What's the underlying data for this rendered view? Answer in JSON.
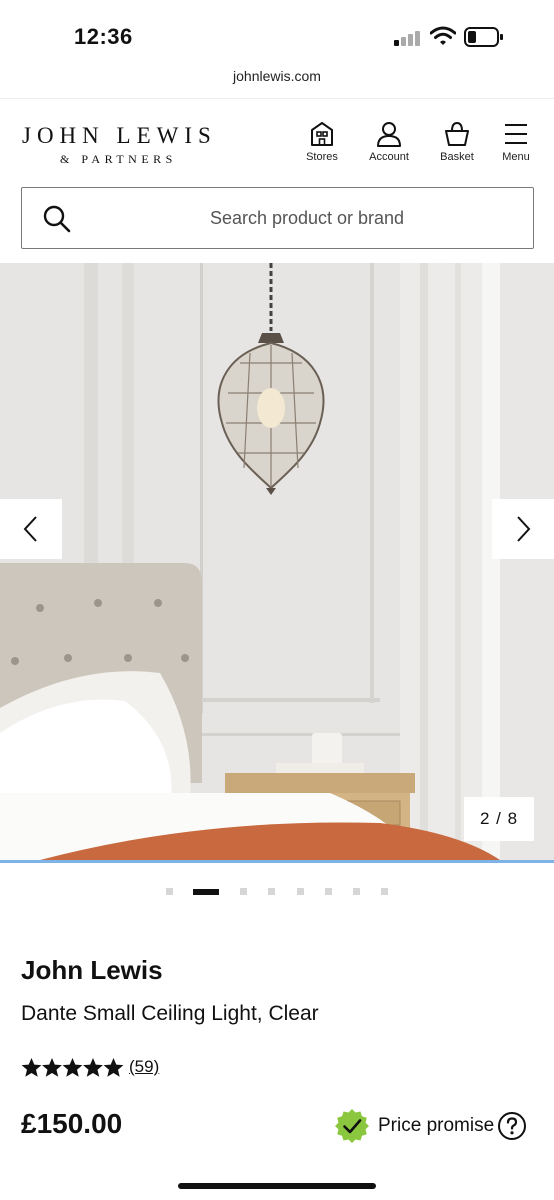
{
  "status_bar": {
    "time": "12:36"
  },
  "browser": {
    "url": "johnlewis.com"
  },
  "header": {
    "logo_main": "JOHN LEWIS",
    "logo_sub": "& PARTNERS",
    "nav": {
      "stores": "Stores",
      "account": "Account",
      "basket": "Basket",
      "menu": "Menu"
    }
  },
  "search": {
    "placeholder": "Search product or brand"
  },
  "gallery": {
    "counter": "2 / 8",
    "current_index": 2,
    "total_images": 8
  },
  "product": {
    "brand": "John Lewis",
    "name": "Dante Small Ceiling Light, Clear",
    "rating_stars": 5,
    "review_count": "(59)",
    "price": "£150.00",
    "price_promise_label": "Price promise"
  },
  "colors": {
    "accent_blue": "#7fb3e8",
    "promise_green": "#8ac73f",
    "text": "#111111"
  }
}
